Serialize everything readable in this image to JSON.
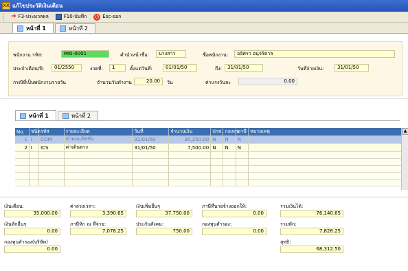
{
  "window": {
    "title": "แก้ไขประวัติเงินเดือน",
    "icon_text": "XX"
  },
  "toolbar": {
    "process_label": "F3-ประมวลผล",
    "save_label": "F10-บันทึก",
    "exit_label": "Esc-ออก"
  },
  "tabs": [
    {
      "label": "หน้าที่ 1"
    },
    {
      "label": "หน้าที่ 2"
    }
  ],
  "header": {
    "emp_code_label": "พนักงาน รหัส:",
    "emp_code": "MKI-0001",
    "prefix_label": "คำนำหน้าชื่อ:",
    "prefix": "นางสาว",
    "name_label": "ชื่อพนักงาน:",
    "name": "อลิศรา อนุจริตาล",
    "period_label": "ประจำเดือน/ปี:",
    "period": "01/2550",
    "round_label": "งวดที่:",
    "round": "1",
    "start_label": "ตั้งแต่วันที่:",
    "start_date": "01/01/50",
    "to_label": "ถึง:",
    "end_date": "31/01/50",
    "paydate_label": "วันที่จ่ายเงิน:",
    "pay_date": "31/01/50",
    "daily_label": "กรณีที่เป็นพนักงานรายวัน",
    "workdays_label": "จำนวนวันทำงาน",
    "workdays": "20.00",
    "unit_day": "วัน",
    "daily_wage_label": "ค่าแรงวันละ",
    "daily_wage": "0.00"
  },
  "grid": {
    "tabs": [
      {
        "label": "หน้าที่ 1"
      },
      {
        "label": "หน้าที่ 2"
      }
    ],
    "columns": [
      "No.",
      "ชนิด",
      "รหัส",
      "รายละเอียด",
      "วันที่",
      "จำนวนเงิน",
      "ปกส.",
      "กองทุน",
      "ภาษี",
      "หมายเหตุ"
    ],
    "rows": [
      {
        "no": "1",
        "type": "I",
        "code": "COM",
        "desc": "ค่าคอมมิชชั่น",
        "date": "31/01/50",
        "amount": "30,250.00",
        "sso": "N",
        "fund": "N",
        "tax": "N",
        "note": ""
      },
      {
        "no": "2",
        "type": "I",
        "code": "ICS",
        "desc": "ค่าเดินทาง",
        "date": "31/01/50",
        "amount": "7,500.00",
        "sso": "N",
        "fund": "N",
        "tax": "N",
        "note": ""
      }
    ]
  },
  "summary": {
    "salary_label": "เงินเดือน:",
    "salary": "35,000.00",
    "ot_label": "ค่าล่วงเวลา:",
    "ot": "3,390.65",
    "extra_label": "เงินเพิ่มอื่นๆ",
    "extra": "37,750.00",
    "tax_self_label": "ภาษีที่นายจ้างออกให้:",
    "tax_self": "0.00",
    "total_income_label": "รวมเงินได้:",
    "total_income": "76,140.65",
    "deduct_label": "เงินหักอื่นๆ",
    "deduct": "0.00",
    "withhold_label": "ภาษีหัก ณ ที่จ่าย:",
    "withhold": "7,078.25",
    "sso_label": "ประกันสังคม:",
    "sso": "750.00",
    "pf_label": "กองทุนสำรอง:",
    "pf": "0.00",
    "total_deduct_label": "รวมหัก:",
    "total_deduct": "7,828.25",
    "pf_company_label": "กองทุนสำรอง(บริษัท)",
    "pf_company": "0.00",
    "net_label": "สุทธิ:",
    "net": "68,312.50"
  }
}
